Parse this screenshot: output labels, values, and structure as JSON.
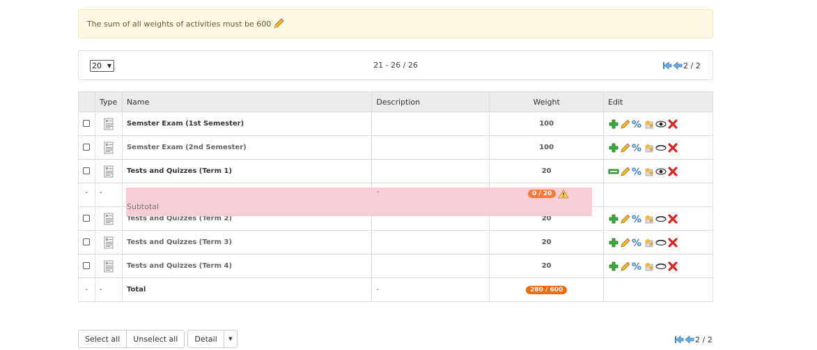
{
  "warning": {
    "text": "The sum of all weights of activities must be 600"
  },
  "pager": {
    "per_page": "20",
    "range": "21 - 26 / 26",
    "page": "2 / 2"
  },
  "table": {
    "headers": {
      "type": "Type",
      "name": "Name",
      "description": "Description",
      "weight": "Weight",
      "edit": "Edit"
    },
    "rows": [
      {
        "name": "Semster Exam (1st Semester)",
        "weight": "100",
        "style": "bold",
        "first_icon": "add"
      },
      {
        "name": "Semster Exam (2nd Semester)",
        "weight": "100",
        "style": "grey",
        "first_icon": "add"
      },
      {
        "name": "Tests and Quizzes (Term 1)",
        "weight": "20",
        "style": "bold",
        "first_icon": "collapse"
      }
    ],
    "subtotal": {
      "chk": "-",
      "type": "-",
      "label": "Subtotal",
      "description": "-",
      "badge": "0 / 20"
    },
    "rows2": [
      {
        "name": "Tests and Quizzes (Term 2)",
        "weight": "20"
      },
      {
        "name": "Tests and Quizzes (Term 3)",
        "weight": "20"
      },
      {
        "name": "Tests and Quizzes (Term 4)",
        "weight": "20"
      }
    ],
    "total": {
      "chk": "-",
      "type": "-",
      "label": "Total",
      "description": "-",
      "badge": "280 / 600"
    }
  },
  "buttons": {
    "select_all": "Select all",
    "unselect_all": "Unselect all",
    "detail": "Detail"
  },
  "bottom_pager": {
    "page": "2 / 2"
  },
  "colors": {
    "warning_bg": "#fcf8e3",
    "subtotal_bg": "#f9cdd6",
    "badge": "#f47a3b"
  }
}
